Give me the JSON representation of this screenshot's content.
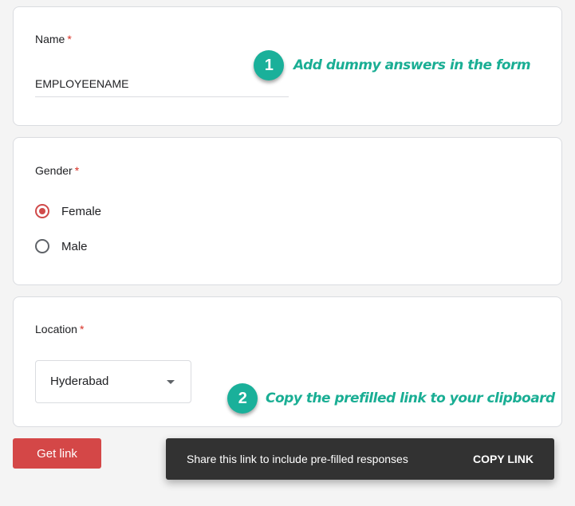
{
  "name_q": {
    "label": "Name",
    "required": "*",
    "value": "EMPLOYEENAME"
  },
  "gender_q": {
    "label": "Gender",
    "required": "*",
    "options": [
      {
        "label": "Female",
        "selected": true
      },
      {
        "label": "Male",
        "selected": false
      }
    ]
  },
  "location_q": {
    "label": "Location",
    "required": "*",
    "selected": "Hyderabad"
  },
  "annotations": [
    {
      "number": "1",
      "text": "Add dummy answers in the form"
    },
    {
      "number": "2",
      "text": "Copy the prefilled link to your clipboard"
    }
  ],
  "get_link": "Get link",
  "snackbar": {
    "message": "Share this link to include pre-filled responses",
    "action": "COPY LINK"
  },
  "colors": {
    "accent": "#d44747",
    "annotation": "#1ab09a"
  }
}
